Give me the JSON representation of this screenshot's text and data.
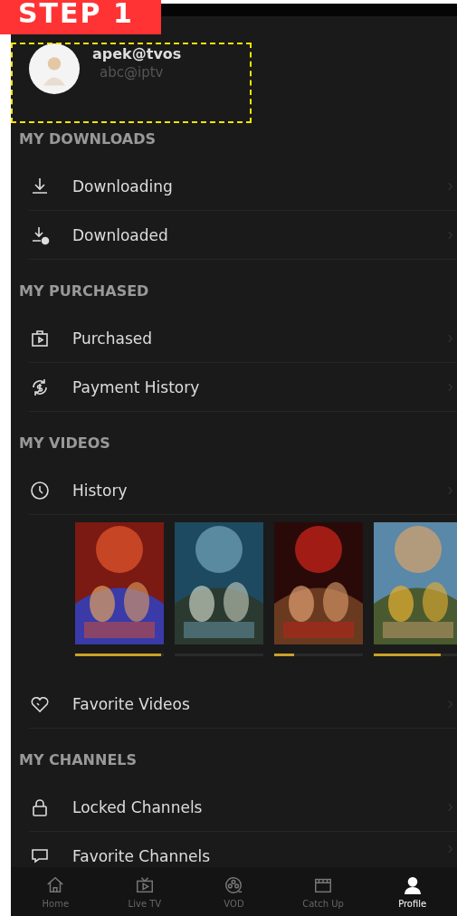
{
  "step_label": "STEP 1",
  "profile": {
    "name": "apek@tvos",
    "account": "abc@iptv"
  },
  "sections": [
    {
      "title": "MY DOWNLOADS",
      "items": [
        {
          "label": "Downloading"
        },
        {
          "label": "Downloaded"
        }
      ]
    },
    {
      "title": "MY PURCHASED",
      "items": [
        {
          "label": "Purchased"
        },
        {
          "label": "Payment History"
        }
      ]
    },
    {
      "title": "MY VIDEOS",
      "items": [
        {
          "label": "History",
          "posters": [
            {
              "kind": "picture",
              "level": 0.97
            },
            {
              "kind": "picture"
            },
            {
              "kind": "picture",
              "level": 0.22
            },
            {
              "kind": "picture",
              "level": 0.76
            }
          ]
        },
        {
          "label": "Favorite Videos"
        }
      ]
    },
    {
      "title": "MY CHANNELS",
      "items": [
        {
          "label": "Locked Channels"
        },
        {
          "label": "Favorite Channels"
        }
      ]
    }
  ],
  "tabs": [
    {
      "label": "Home",
      "selected": false
    },
    {
      "label": "Live TV",
      "selected": false
    },
    {
      "label": "VOD",
      "selected": false
    },
    {
      "label": "Catch Up",
      "selected": false
    },
    {
      "label": "Profile",
      "selected": true
    }
  ]
}
